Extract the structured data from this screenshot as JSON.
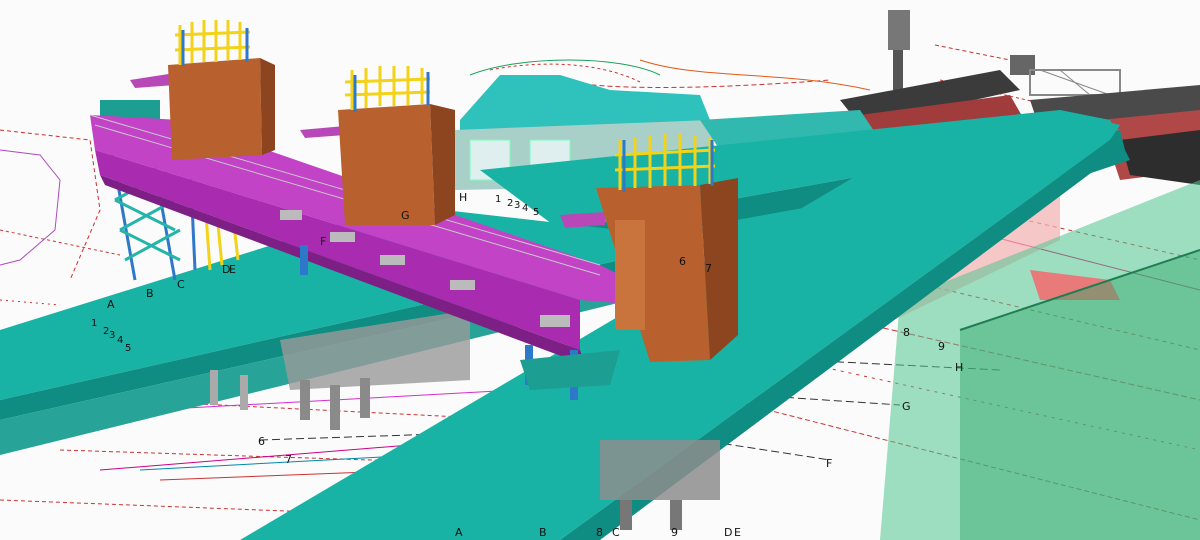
{
  "viewport": {
    "colors": {
      "deck": "#19b3a5",
      "deck_dark": "#0f8d82",
      "bridge": "#a82bb0",
      "tower": "#b8612e",
      "tower_dark": "#8d4520",
      "rebar": "#f3d21a",
      "steel_blue": "#2e78c9",
      "platform_red": "#a03c3c",
      "grid_red": "#e02b2b"
    },
    "grid_labels": {
      "left_cluster": [
        "A",
        "B",
        "C",
        "D",
        "E"
      ],
      "left_numbers": [
        "1",
        "2",
        "3",
        "4",
        "5"
      ],
      "mid_numbers": [
        "1",
        "2",
        "3",
        "4",
        "5"
      ],
      "mid_letters": [
        "H",
        "G",
        "F"
      ],
      "tower_numbers": [
        "6",
        "7"
      ],
      "right_numbers": [
        "8",
        "9"
      ],
      "right_letters": [
        "H",
        "G",
        "F"
      ],
      "left_lower_numbers": [
        "6",
        "7"
      ],
      "bottom_letters": [
        "A",
        "B",
        "8",
        "C",
        "9",
        "D",
        "E"
      ]
    }
  }
}
